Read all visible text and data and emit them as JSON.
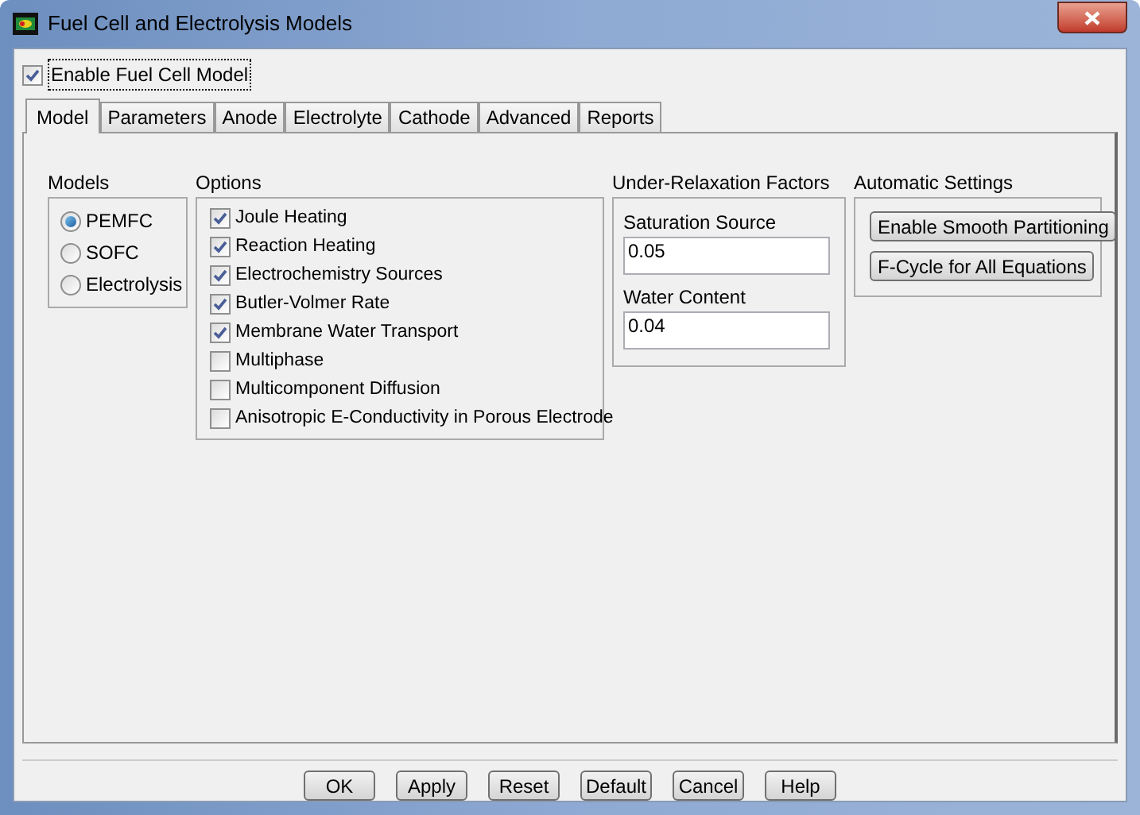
{
  "window": {
    "title": "Fuel Cell and Electrolysis Models"
  },
  "enable": {
    "label": "Enable Fuel Cell Model",
    "checked": true
  },
  "tabs": [
    {
      "label": "Model",
      "selected": true
    },
    {
      "label": "Parameters",
      "selected": false
    },
    {
      "label": "Anode",
      "selected": false
    },
    {
      "label": "Electrolyte",
      "selected": false
    },
    {
      "label": "Cathode",
      "selected": false
    },
    {
      "label": "Advanced",
      "selected": false
    },
    {
      "label": "Reports",
      "selected": false
    }
  ],
  "models": {
    "title": "Models",
    "items": [
      {
        "label": "PEMFC",
        "selected": true
      },
      {
        "label": "SOFC",
        "selected": false
      },
      {
        "label": "Electrolysis",
        "selected": false
      }
    ]
  },
  "options": {
    "title": "Options",
    "items": [
      {
        "label": "Joule Heating",
        "checked": true
      },
      {
        "label": "Reaction Heating",
        "checked": true
      },
      {
        "label": "Electrochemistry Sources",
        "checked": true
      },
      {
        "label": "Butler-Volmer Rate",
        "checked": true
      },
      {
        "label": "Membrane Water Transport",
        "checked": true
      },
      {
        "label": "Multiphase",
        "checked": false
      },
      {
        "label": "Multicomponent Diffusion",
        "checked": false
      },
      {
        "label": "Anisotropic E-Conductivity in Porous Electrode",
        "checked": false
      }
    ]
  },
  "under_relaxation": {
    "title": "Under-Relaxation Factors",
    "fields": [
      {
        "label": "Saturation Source",
        "value": "0.05"
      },
      {
        "label": "Water Content",
        "value": "0.04"
      }
    ]
  },
  "automatic": {
    "title": "Automatic Settings",
    "buttons": [
      "Enable Smooth Partitioning",
      "F-Cycle for All Equations"
    ]
  },
  "buttons": [
    "OK",
    "Apply",
    "Reset",
    "Default",
    "Cancel",
    "Help"
  ]
}
